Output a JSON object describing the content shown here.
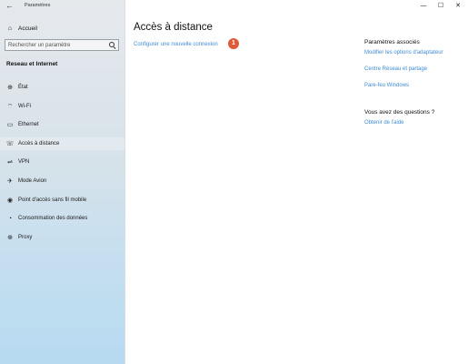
{
  "window": {
    "app_title": "Paramètres",
    "back_icon": "back-arrow-icon",
    "minimize_glyph": "—",
    "maximize_glyph": "☐",
    "close_glyph": "✕"
  },
  "sidebar": {
    "home_label": "Accueil",
    "home_icon": "home-icon",
    "search_placeholder": "Rechercher un paramètre",
    "section_title": "Reseau et Internet",
    "items": [
      {
        "label": "État",
        "icon": "globe-status-icon"
      },
      {
        "label": "Wi-Fi",
        "icon": "wifi-icon"
      },
      {
        "label": "Ethernet",
        "icon": "ethernet-icon"
      },
      {
        "label": "Accès à distance",
        "icon": "dialup-icon",
        "selected": true
      },
      {
        "label": "VPN",
        "icon": "vpn-icon"
      },
      {
        "label": "Mode Avion",
        "icon": "airplane-icon"
      },
      {
        "label": "Point d'accès sans fil mobile",
        "icon": "hotspot-icon"
      },
      {
        "label": "Consommation des données",
        "icon": "data-usage-icon"
      },
      {
        "label": "Proxy",
        "icon": "proxy-globe-icon"
      }
    ]
  },
  "main": {
    "title": "Accès à distance",
    "setup_link": "Configurer une nouvelle connexion",
    "badge": "1"
  },
  "related": {
    "title": "Paramètres associés",
    "links": [
      "Modifier les options d'adaptateur",
      "Centre Réseau et partage",
      "Pare-feu Windows"
    ]
  },
  "questions": {
    "title": "Vous avez des questions ?",
    "help_link": "Obtenir de l'aide"
  },
  "colors": {
    "accent": "#3f8bd1",
    "badge": "#e05a3a"
  }
}
